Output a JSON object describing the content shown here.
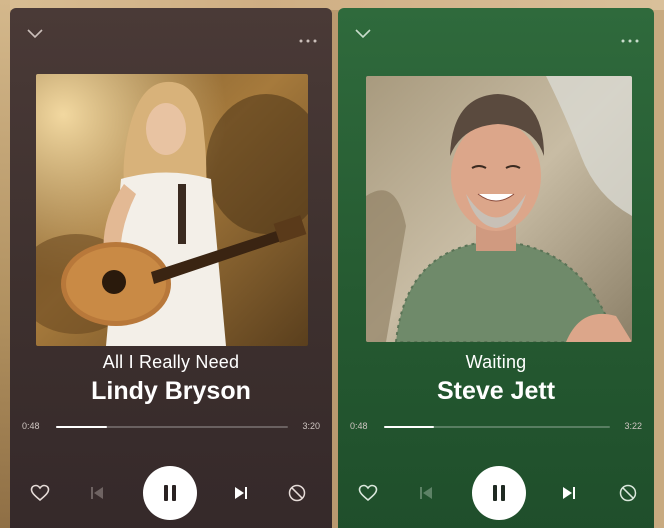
{
  "players": [
    {
      "title": "All I Really Need",
      "artist": "Lindy Bryson",
      "elapsed": "0:48",
      "total": "3:20",
      "progress_fraction": 0.22,
      "background_color": "#3d302e"
    },
    {
      "title": "Waiting",
      "artist": "Steve Jett",
      "elapsed": "0:48",
      "total": "3:22",
      "progress_fraction": 0.22,
      "background_color": "#255a31"
    }
  ],
  "icons": {
    "collapse": "chevron-down-icon",
    "menu": "more-options-icon",
    "like": "heart-icon",
    "previous": "skip-previous-icon",
    "play_pause": "pause-icon",
    "next": "skip-next-icon",
    "hide": "block-icon"
  }
}
